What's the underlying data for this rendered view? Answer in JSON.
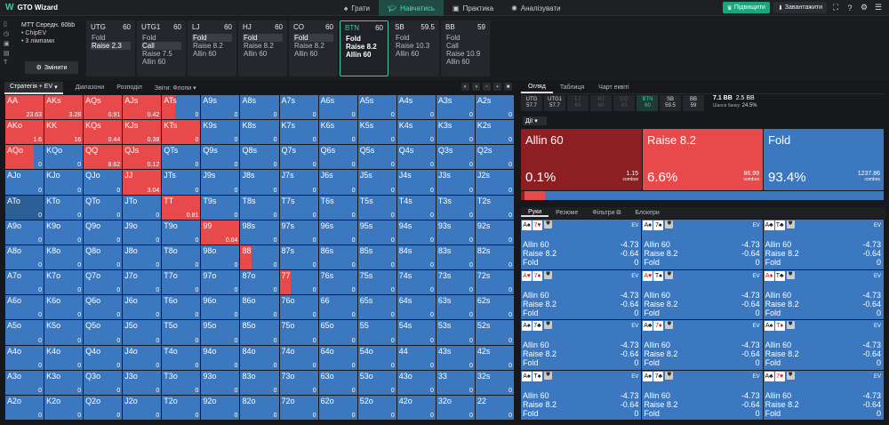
{
  "app": {
    "name": "GTO Wizard"
  },
  "nav": {
    "tabs": [
      {
        "label": "Грати",
        "icon": "spade-icon"
      },
      {
        "label": "Навчатись",
        "icon": "graduation-icon"
      },
      {
        "label": "Практика",
        "icon": "gamepad-icon"
      },
      {
        "label": "Аналізувати",
        "icon": "sun-icon"
      }
    ]
  },
  "topright": {
    "upgrade": "Підвищити",
    "download": "Завантажити"
  },
  "spot": {
    "line1": "MTT Середн. 60bb",
    "line2": "• ChipEV",
    "line3": "• 3 лімпами",
    "change": "Змінити"
  },
  "positions": [
    {
      "name": "UTG",
      "stack": "60",
      "actions": [
        "Fold",
        "Raise 2.3"
      ],
      "sel": 1
    },
    {
      "name": "UTG1",
      "stack": "60",
      "actions": [
        "Fold",
        "Call",
        "Raise 7.5",
        "Allin 60"
      ],
      "sel": 1
    },
    {
      "name": "LJ",
      "stack": "60",
      "actions": [
        "Fold",
        "Raise 8.2",
        "Allin 60"
      ],
      "sel": 0
    },
    {
      "name": "HJ",
      "stack": "60",
      "actions": [
        "Fold",
        "Raise 8.2",
        "Allin 60"
      ],
      "sel": 0
    },
    {
      "name": "CO",
      "stack": "60",
      "actions": [
        "Fold",
        "Raise 8.2",
        "Allin 60"
      ],
      "sel": 0
    },
    {
      "name": "BTN",
      "stack": "60",
      "actions": [
        "Fold",
        "Raise 8.2",
        "Allin 60"
      ],
      "sel": -1
    },
    {
      "name": "SB",
      "stack": "59.5",
      "actions": [
        "Fold",
        "Raise 10.3",
        "Allin 60"
      ],
      "sel": -1
    },
    {
      "name": "BB",
      "stack": "59",
      "actions": [
        "Fold",
        "Call",
        "Raise 10.9",
        "Allin 60"
      ],
      "sel": -1
    }
  ],
  "lefttabs": {
    "strategy": "Стратегія + EV",
    "ranges": "Діапазони",
    "breakdown": "Розподіл",
    "reports": "Звіти: Флопи"
  },
  "grid": {
    "hands": [
      [
        "AA",
        "AKs",
        "AQs",
        "AJs",
        "ATs",
        "A9s",
        "A8s",
        "A7s",
        "A6s",
        "A5s",
        "A4s",
        "A3s",
        "A2s"
      ],
      [
        "AKo",
        "KK",
        "KQs",
        "KJs",
        "KTs",
        "K9s",
        "K8s",
        "K7s",
        "K6s",
        "K5s",
        "K4s",
        "K3s",
        "K2s"
      ],
      [
        "AQo",
        "KQo",
        "QQ",
        "QJs",
        "QTs",
        "Q9s",
        "Q8s",
        "Q7s",
        "Q6s",
        "Q5s",
        "Q4s",
        "Q3s",
        "Q2s"
      ],
      [
        "AJo",
        "KJo",
        "QJo",
        "JJ",
        "JTs",
        "J9s",
        "J8s",
        "J7s",
        "J6s",
        "J5s",
        "J4s",
        "J3s",
        "J2s"
      ],
      [
        "ATo",
        "KTo",
        "QTo",
        "JTo",
        "TT",
        "T9s",
        "T8s",
        "T7s",
        "T6s",
        "T5s",
        "T4s",
        "T3s",
        "T2s"
      ],
      [
        "A9o",
        "K9o",
        "Q9o",
        "J9o",
        "T9o",
        "99",
        "98s",
        "97s",
        "96s",
        "95s",
        "94s",
        "93s",
        "92s"
      ],
      [
        "A8o",
        "K8o",
        "Q8o",
        "J8o",
        "T8o",
        "98o",
        "88",
        "87s",
        "86s",
        "85s",
        "84s",
        "83s",
        "82s"
      ],
      [
        "A7o",
        "K7o",
        "Q7o",
        "J7o",
        "T7o",
        "97o",
        "87o",
        "77",
        "76s",
        "75s",
        "74s",
        "73s",
        "72s"
      ],
      [
        "A6o",
        "K6o",
        "Q6o",
        "J6o",
        "T6o",
        "96o",
        "86o",
        "76o",
        "66",
        "65s",
        "64s",
        "63s",
        "62s"
      ],
      [
        "A5o",
        "K5o",
        "Q5o",
        "J5o",
        "T5o",
        "95o",
        "85o",
        "75o",
        "65o",
        "55",
        "54s",
        "53s",
        "52s"
      ],
      [
        "A4o",
        "K4o",
        "Q4o",
        "J4o",
        "T4o",
        "94o",
        "84o",
        "74o",
        "64o",
        "54o",
        "44",
        "43s",
        "42s"
      ],
      [
        "A3o",
        "K3o",
        "Q3o",
        "J3o",
        "T3o",
        "93o",
        "83o",
        "73o",
        "63o",
        "53o",
        "43o",
        "33",
        "32s"
      ],
      [
        "A2o",
        "K2o",
        "Q2o",
        "J2o",
        "T2o",
        "92o",
        "82o",
        "72o",
        "62o",
        "52o",
        "42o",
        "32o",
        "22"
      ]
    ],
    "special": {
      "AA": {
        "ev": "23.63",
        "raise": 1,
        "allin": 0
      },
      "AKs": {
        "ev": "3.28",
        "raise": 1,
        "allin": 0
      },
      "AQs": {
        "ev": "0.91",
        "raise": 1,
        "allin": 0
      },
      "AJs": {
        "ev": "0.42",
        "raise": 1,
        "allin": 0
      },
      "ATs": {
        "ev": "0",
        "raise": 0.33,
        "allin": 0
      },
      "AKo": {
        "ev": "1.6",
        "raise": 1,
        "allin": 0
      },
      "KK": {
        "ev": "16",
        "raise": 1,
        "allin": 0
      },
      "KQs": {
        "ev": "0.44",
        "raise": 1,
        "allin": 0
      },
      "KJs": {
        "ev": "0.38",
        "raise": 1,
        "allin": 0
      },
      "KTs": {
        "ev": "0",
        "raise": 1,
        "allin": 0
      },
      "AQo": {
        "ev": "0",
        "raise": 0.75,
        "allin": 0
      },
      "QQ": {
        "ev": "8.62",
        "raise": 1,
        "allin": 0
      },
      "QJs": {
        "ev": "0.12",
        "raise": 1,
        "allin": 0
      },
      "JJ": {
        "ev": "3.04",
        "raise": 1,
        "allin": 0
      },
      "TT": {
        "ev": "0.81",
        "raise": 1,
        "allin": 0
      },
      "99": {
        "ev": "0.04",
        "raise": 1,
        "allin": 0
      },
      "88": {
        "ev": "0",
        "raise": 0.3,
        "allin": 0
      },
      "77": {
        "ev": "0",
        "raise": 0.3,
        "allin": 0
      }
    },
    "default_ev": "0",
    "dark_cells": [
      "ATo"
    ]
  },
  "righttabs": {
    "overview": "Огляд",
    "table": "Таблиця",
    "equity": "Чарт еквіті"
  },
  "posbar": [
    {
      "n": "UTG",
      "s": "57.7",
      "state": "normal"
    },
    {
      "n": "UTG1",
      "s": "57.7",
      "state": "normal"
    },
    {
      "n": "LJ",
      "s": "60",
      "state": "dim"
    },
    {
      "n": "HJ",
      "s": "60",
      "state": "dim"
    },
    {
      "n": "CO",
      "s": "60",
      "state": "dim"
    },
    {
      "n": "BTN",
      "s": "60",
      "state": "act"
    },
    {
      "n": "SB",
      "s": "59.5",
      "state": "normal"
    },
    {
      "n": "BB",
      "s": "59",
      "state": "normal"
    }
  ],
  "pot": {
    "value": "7.1 BB",
    "extra": "2.5 BB",
    "label": "Шанси банку:",
    "odds": "24.5%"
  },
  "actions_dropdown": "Дії",
  "summary": [
    {
      "name": "Allin 60",
      "pct": "0.1%",
      "combos": "1.15",
      "color": "#8d1e22"
    },
    {
      "name": "Raise 8.2",
      "pct": "6.6%",
      "combos": "86.99",
      "color": "#e8494b"
    },
    {
      "name": "Fold",
      "pct": "93.4%",
      "combos": "1237.86",
      "color": "#3b78c0"
    }
  ],
  "combos_label": "combos",
  "freq": {
    "allin": 0.001,
    "raise": 0.066
  },
  "handtabs": {
    "hands": "Руки",
    "summary": "Резюме",
    "filters": "Фільтри",
    "blockers": "Блокери"
  },
  "handcards": [
    {
      "c1": "A♠",
      "c1r": false,
      "c2": "7♥",
      "c2r": true
    },
    {
      "c1": "A♠",
      "c1r": false,
      "c2": "7♠",
      "c2r": false
    },
    {
      "c1": "A♣",
      "c1r": false,
      "c2": "T♣",
      "c2r": false
    },
    {
      "c1": "A♥",
      "c1r": true,
      "c2": "7♦",
      "c2r": true
    },
    {
      "c1": "A♥",
      "c1r": true,
      "c2": "T♠",
      "c2r": false
    },
    {
      "c1": "A♦",
      "c1r": true,
      "c2": "T♣",
      "c2r": false
    },
    {
      "c1": "A♠",
      "c1r": false,
      "c2": "7♣",
      "c2r": false
    },
    {
      "c1": "A♣",
      "c1r": false,
      "c2": "7♦",
      "c2r": true
    },
    {
      "c1": "A♠",
      "c1r": false,
      "c2": "T♦",
      "c2r": true
    },
    {
      "c1": "A♠",
      "c1r": false,
      "c2": "T♠",
      "c2r": false
    },
    {
      "c1": "A♠",
      "c1r": false,
      "c2": "7♣",
      "c2r": false
    },
    {
      "c1": "A♣",
      "c1r": false,
      "c2": "7♥",
      "c2r": true
    }
  ],
  "handrows": [
    {
      "label": "Allin 60",
      "ev": "-4.73"
    },
    {
      "label": "Raise 8.2",
      "ev": "-0.64"
    },
    {
      "label": "Fold",
      "ev": "0"
    }
  ],
  "ev_label": "EV"
}
